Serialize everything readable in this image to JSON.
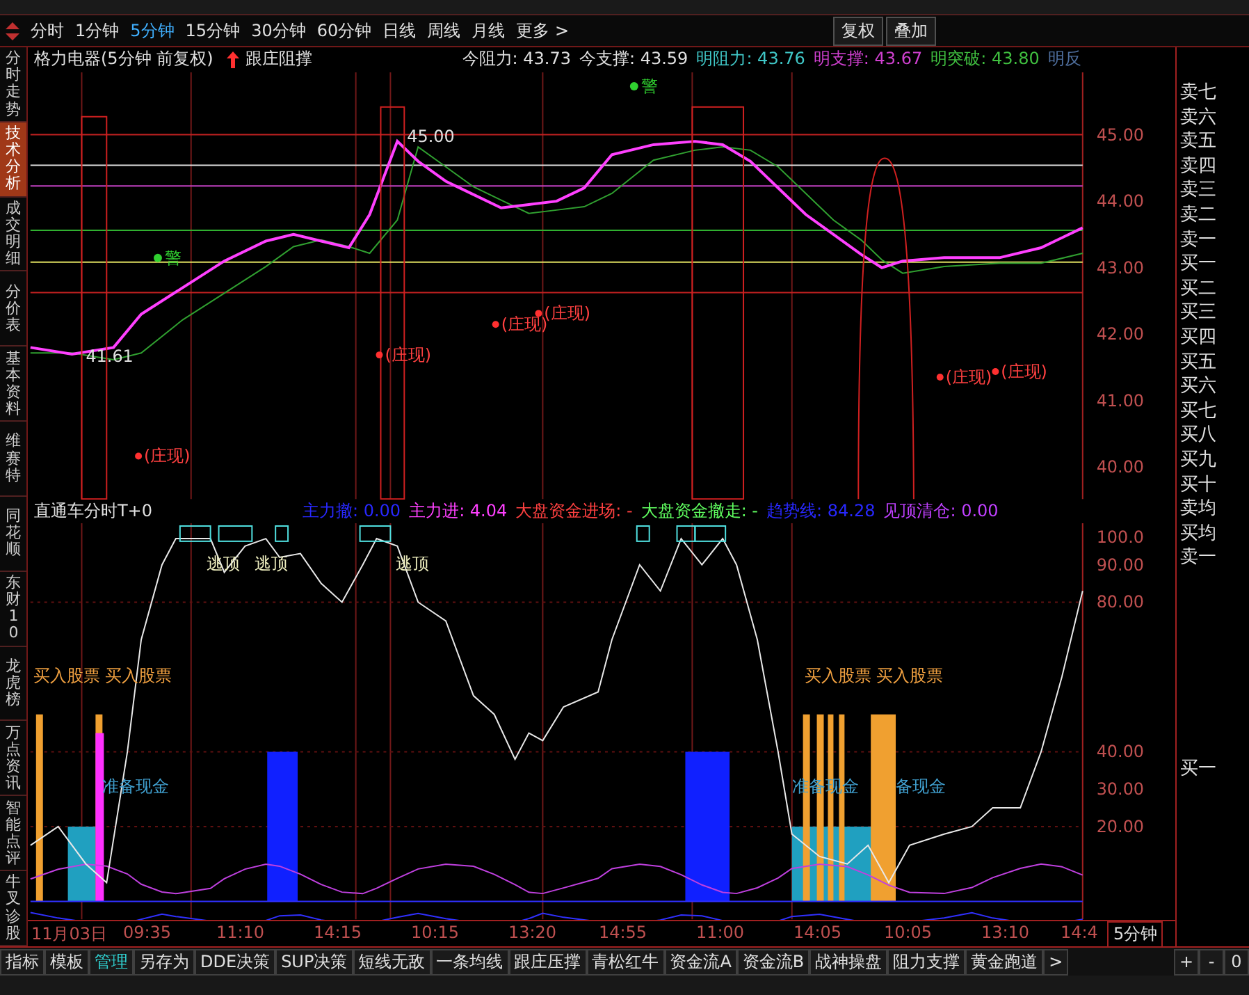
{
  "period_tabs": [
    {
      "label": "分时",
      "selected": false
    },
    {
      "label": "1分钟",
      "selected": false
    },
    {
      "label": "5分钟",
      "selected": true
    },
    {
      "label": "15分钟",
      "selected": false
    },
    {
      "label": "30分钟",
      "selected": false
    },
    {
      "label": "60分钟",
      "selected": false
    },
    {
      "label": "日线",
      "selected": false
    },
    {
      "label": "周线",
      "selected": false
    },
    {
      "label": "月线",
      "selected": false
    },
    {
      "label": "更多 >",
      "selected": false
    }
  ],
  "toolbar_buttons": [
    "复权",
    "叠加"
  ],
  "side_tabs": [
    {
      "label": "分时走势",
      "selected": false
    },
    {
      "label": "技术分析",
      "selected": true
    },
    {
      "label": "成交明细",
      "selected": false
    },
    {
      "label": "分价表",
      "selected": false
    },
    {
      "label": "基本资料",
      "selected": false
    },
    {
      "label": "维赛特",
      "selected": false
    },
    {
      "label": "同花顺",
      "selected": false
    },
    {
      "label": "东财10",
      "selected": false
    },
    {
      "label": "龙虎榜",
      "selected": false
    },
    {
      "label": "万点资讯",
      "selected": false
    },
    {
      "label": "智能点评",
      "selected": false
    },
    {
      "label": "牛叉诊股",
      "selected": false
    }
  ],
  "main_header": {
    "title": "格力电器(5分钟 前复权)",
    "indicator": "跟庄阻撑",
    "values": [
      {
        "label": "今阻力:",
        "value": "43.73",
        "color": "#e0e0e0"
      },
      {
        "label": "今支撑:",
        "value": "43.59",
        "color": "#e0e0e0"
      },
      {
        "label": "明阻力:",
        "value": "43.76",
        "color": "#40c8c8"
      },
      {
        "label": "明支撑:",
        "value": "43.67",
        "color": "#d040d0"
      },
      {
        "label": "明突破:",
        "value": "43.80",
        "color": "#40c040"
      },
      {
        "label": "明反",
        "color": "#5070a0"
      }
    ]
  },
  "main_chart": {
    "y_axis": [
      "45.00",
      "44.00",
      "43.00",
      "42.00",
      "41.00",
      "40.00"
    ],
    "price_labels": [
      "45.00",
      "41.61"
    ],
    "signals": [
      "(庄现)",
      "(庄现)",
      "(庄现)",
      "(庄现)",
      "(庄现)",
      "(庄现)"
    ],
    "alerts": [
      "警",
      "警"
    ]
  },
  "indicator_header": {
    "title": "直通车分时T+0",
    "values": [
      {
        "label": "主力撤:",
        "value": "0.00",
        "color": "#2828ff"
      },
      {
        "label": "主力进:",
        "value": "4.04",
        "color": "#ff40ff"
      },
      {
        "label": "大盘资金进场:",
        "value": "-",
        "color": "#ff4040"
      },
      {
        "label": "大盘资金撤走:",
        "value": "-",
        "color": "#60ff60"
      },
      {
        "label": "趋势线:",
        "value": "84.28",
        "color": "#2828ff"
      },
      {
        "label": "见顶清仓:",
        "value": "0.00",
        "color": "#c040ff"
      }
    ]
  },
  "indicator_chart": {
    "y_axis": [
      "100.0",
      "90.00",
      "80.00",
      "40.00",
      "30.00",
      "20.00"
    ],
    "escape_labels": [
      "逃顶",
      "逃顶",
      "逃顶"
    ],
    "buy_labels": [
      "买入股票",
      "买入股票",
      "买入股票",
      "买入股票"
    ],
    "cash_labels": [
      "准备现金",
      "准备现金",
      "备现金"
    ]
  },
  "order_book": [
    "卖七",
    "卖六",
    "卖五",
    "卖四",
    "卖三",
    "卖二",
    "卖一",
    "买一",
    "买二",
    "买三",
    "买四",
    "买五",
    "买六",
    "买七",
    "买八",
    "买九",
    "买十",
    "卖均",
    "买均",
    "卖一"
  ],
  "order_book_extra": "买一",
  "time_axis": [
    "11月03日",
    "09:35",
    "11:10",
    "14:15",
    "10:15",
    "13:20",
    "14:55",
    "11:00",
    "14:05",
    "10:05",
    "13:10",
    "14:4"
  ],
  "period_label": "5分钟",
  "bottom_tabs": [
    {
      "label": "指标",
      "selected": false
    },
    {
      "label": "模板",
      "selected": false
    },
    {
      "label": "管理",
      "selected": true
    },
    {
      "label": "另存为",
      "selected": false
    },
    {
      "label": "DDE决策",
      "selected": false
    },
    {
      "label": "SUP决策",
      "selected": false
    },
    {
      "label": "短线无敌",
      "selected": false
    },
    {
      "label": "一条均线",
      "selected": false
    },
    {
      "label": "跟庄压撑",
      "selected": false
    },
    {
      "label": "青松红牛",
      "selected": false
    },
    {
      "label": "资金流A",
      "selected": false
    },
    {
      "label": "资金流B",
      "selected": false
    },
    {
      "label": "战神操盘",
      "selected": false
    },
    {
      "label": "阻力支撑",
      "selected": false
    },
    {
      "label": "黄金跑道",
      "selected": false
    },
    {
      "label": ">",
      "selected": false
    }
  ],
  "zoom_buttons": [
    "+",
    "-",
    "0"
  ]
}
